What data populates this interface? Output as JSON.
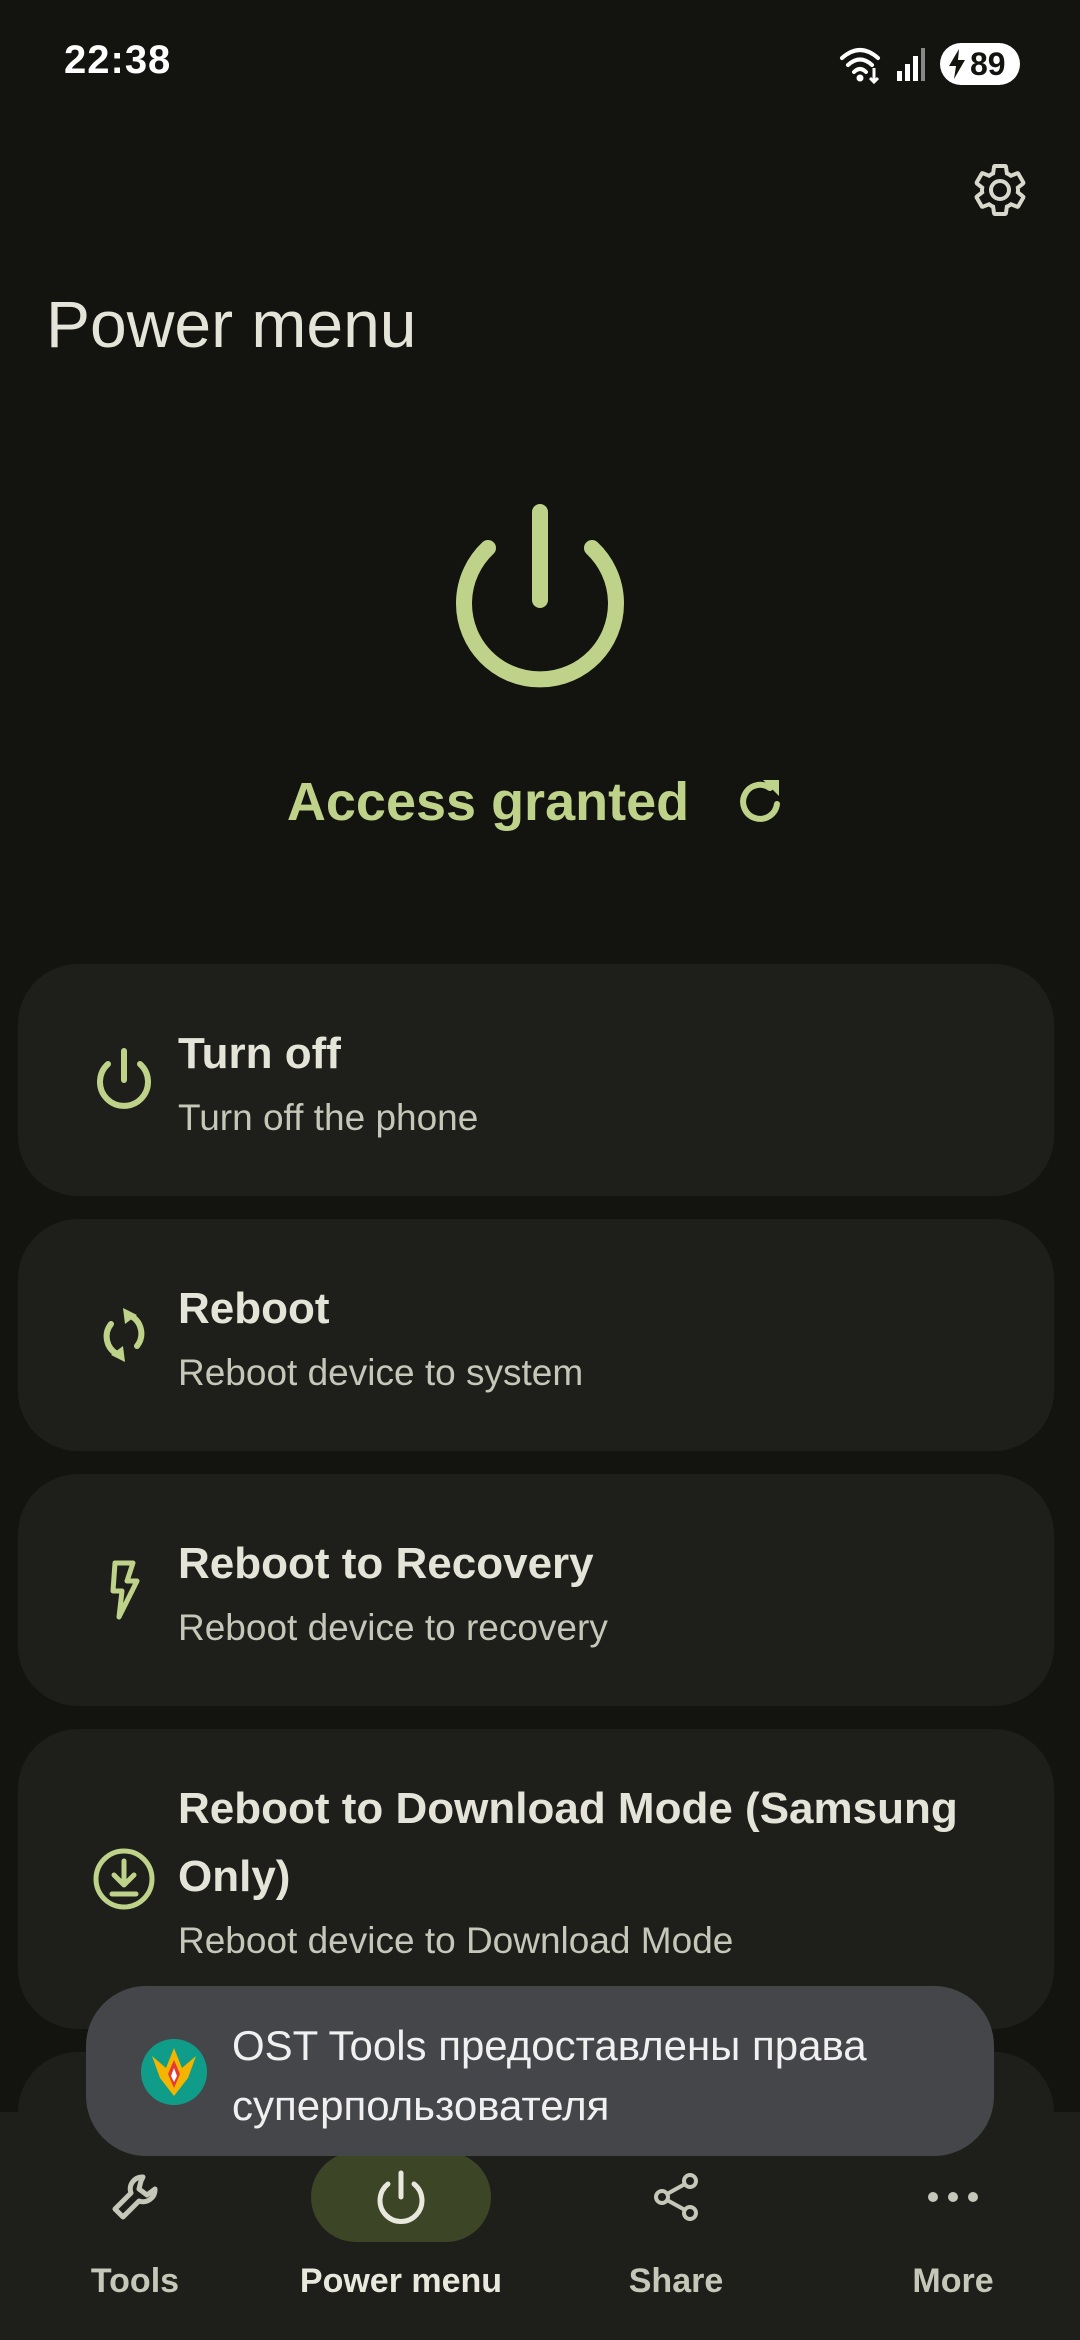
{
  "status_bar": {
    "time": "22:38",
    "battery": "89"
  },
  "header": {
    "title": "Power menu"
  },
  "hero": {
    "status": "Access granted"
  },
  "actions": [
    {
      "title": "Turn off",
      "subtitle": "Turn off the phone",
      "icon": "power-icon"
    },
    {
      "title": "Reboot",
      "subtitle": "Reboot device to system",
      "icon": "reboot-icon"
    },
    {
      "title": "Reboot to Recovery",
      "subtitle": "Reboot device to recovery",
      "icon": "lightning-icon"
    },
    {
      "title": "Reboot to Download Mode (Samsung Only)",
      "subtitle": "Reboot device to Download Mode",
      "icon": "download-icon"
    }
  ],
  "toast": {
    "message": "OST Tools предоставлены права суперпользователя"
  },
  "bottom_nav": {
    "items": [
      {
        "label": "Tools",
        "icon": "wrench-icon",
        "active": false
      },
      {
        "label": "Power menu",
        "icon": "power-icon",
        "active": true
      },
      {
        "label": "Share",
        "icon": "share-icon",
        "active": false
      },
      {
        "label": "More",
        "icon": "more-icon",
        "active": false
      }
    ]
  },
  "colors": {
    "background": "#13140f",
    "accent": "#bfd28a",
    "card": "#1e1f1a",
    "nav_active_pill": "#3d4527",
    "toast": "#45464a"
  }
}
